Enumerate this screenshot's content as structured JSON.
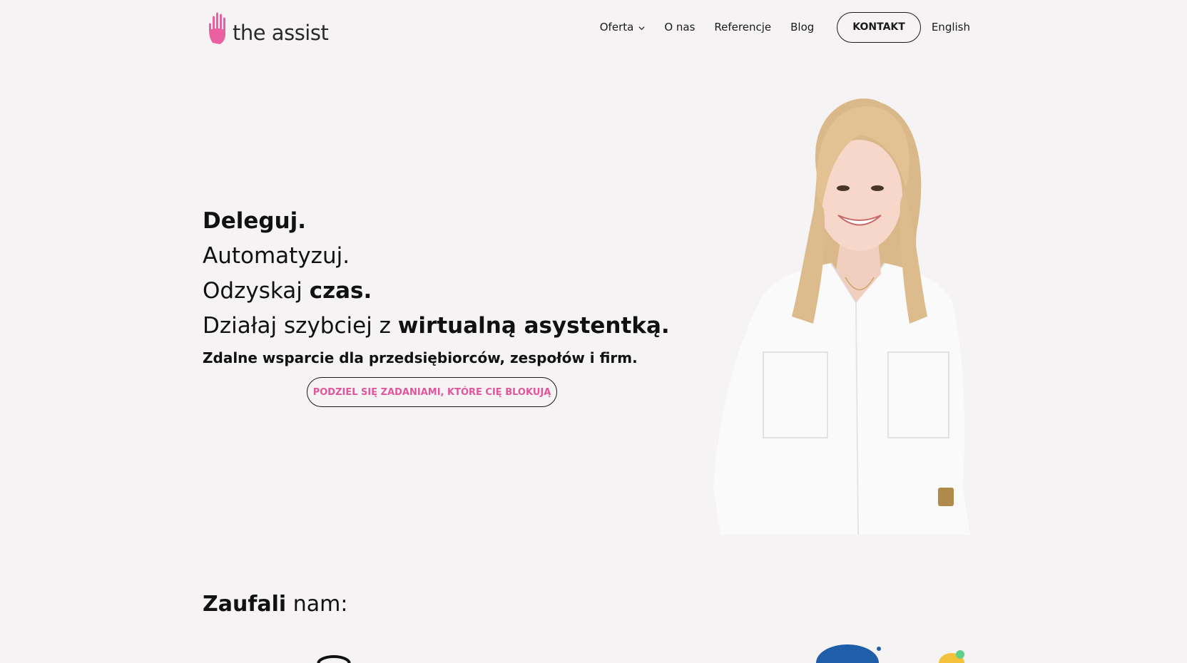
{
  "header": {
    "logo_text": "the assist",
    "nav": [
      {
        "label": "Oferta"
      },
      {
        "label": "O nas"
      },
      {
        "label": "Referencje"
      },
      {
        "label": "Blog"
      }
    ],
    "contact_label": "KONTAKT",
    "language_label": "English"
  },
  "hero": {
    "line1_bold": "Deleguj.",
    "line2": "Automatyzuj.",
    "line3_regular": "Odzyskaj ",
    "line3_bold": "czas.",
    "line4_regular": "Działaj szybciej z ",
    "line4_bold": "wirtualną asystentką.",
    "subtitle": "Zdalne wsparcie dla przedsiębiorców, zespołów i firm.",
    "cta_label": "PODZIEL SIĘ ZADANIAMI, KTÓRE CIĘ BLOKUJĄ"
  },
  "trusted": {
    "bold": "Zaufali",
    "regular": " nam:"
  },
  "colors": {
    "background": "#f5f3f4",
    "accent_pink": "#e0569b",
    "text": "#111111"
  },
  "icons": {
    "logo": "hand-icon",
    "dropdown": "chevron-down-icon"
  }
}
